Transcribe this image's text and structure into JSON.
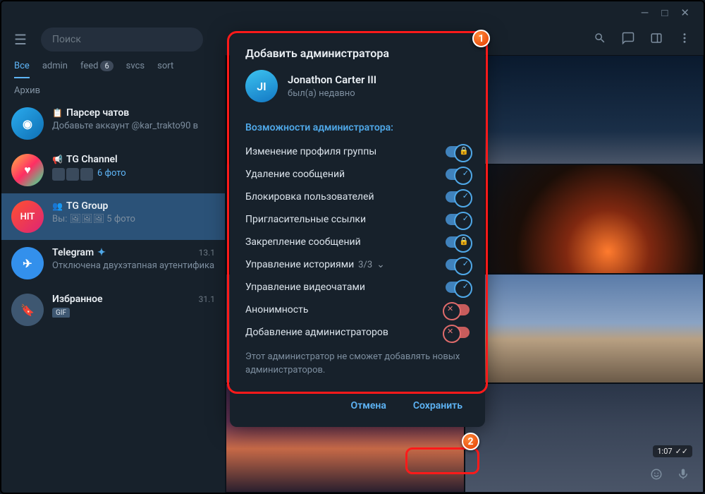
{
  "titlebar": {
    "min": "—",
    "max": "□",
    "close": "✕"
  },
  "search": {
    "placeholder": "Поиск"
  },
  "tabs": [
    {
      "label": "Все",
      "active": true
    },
    {
      "label": "admin"
    },
    {
      "label": "feed",
      "badge": "6"
    },
    {
      "label": "svcs"
    },
    {
      "label": "sort"
    }
  ],
  "archive_label": "Архив",
  "chats": [
    {
      "icon": "eye",
      "name": "Парсер чатов",
      "pre": "📋",
      "sub": "Добавьте аккаунт @kar_trakto90 в"
    },
    {
      "icon": "heart",
      "name": "TG Channel",
      "pre": "📢",
      "sub": "6 фото",
      "thumbs": true,
      "subColor": "#5eb5f7"
    },
    {
      "icon": "HIT",
      "name": "TG Group",
      "pre": "👥",
      "sub": "Вы: 🖼🖼🖼 5 фото",
      "selected": true
    },
    {
      "icon": "plane",
      "name": "Telegram",
      "verified": true,
      "date": "13.1",
      "sub": "Отключена двухэтапная аутентифика"
    },
    {
      "icon": "bm",
      "name": "Избранное",
      "date": "31.1",
      "sub": "GIF",
      "gif": true
    }
  ],
  "modal": {
    "title": "Добавить администратора",
    "user": {
      "initials": "JI",
      "name": "Jonathon Carter III",
      "status": "был(а) недавно"
    },
    "section": "Возможности администратора:",
    "perms": [
      {
        "label": "Изменение профиля группы",
        "on": true,
        "icon": "lock"
      },
      {
        "label": "Удаление сообщений",
        "on": true,
        "icon": "check"
      },
      {
        "label": "Блокировка пользователей",
        "on": true,
        "icon": "check"
      },
      {
        "label": "Пригласительные ссылки",
        "on": true,
        "icon": "check"
      },
      {
        "label": "Закрепление сообщений",
        "on": true,
        "icon": "lock"
      },
      {
        "label": "Управление историями",
        "count": "3/3",
        "chev": true,
        "on": true,
        "icon": "check"
      },
      {
        "label": "Управление видеочатами",
        "on": true,
        "icon": "check"
      },
      {
        "label": "Анонимность",
        "on": false,
        "icon": "x"
      },
      {
        "label": "Добавление администраторов",
        "on": false,
        "icon": "x"
      }
    ],
    "note": "Этот администратор не сможет добавлять новых администраторов.",
    "cancel": "Отмена",
    "save": "Сохранить"
  },
  "gallery_time": "1:07",
  "annotations": {
    "a1": "1",
    "a2": "2"
  }
}
